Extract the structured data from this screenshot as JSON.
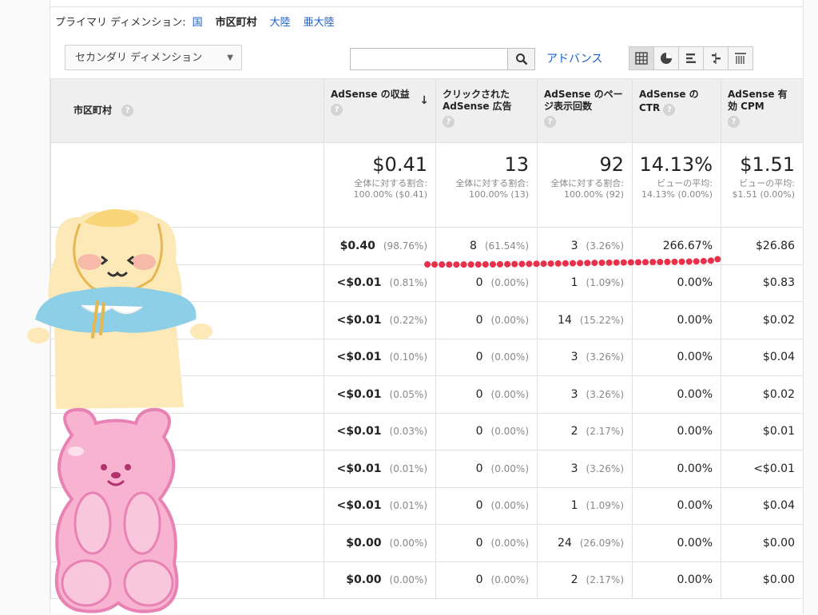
{
  "primary_dimension": {
    "label": "プライマリ ディメンション:",
    "options": [
      {
        "label": "国",
        "active": false
      },
      {
        "label": "市区町村",
        "active": true
      },
      {
        "label": "大陸",
        "active": false
      },
      {
        "label": "亜大陸",
        "active": false
      }
    ]
  },
  "toolbar": {
    "secondary_dimension": "セカンダリ ディメンション",
    "search_value": "",
    "advanced_label": "アドバンス",
    "views": [
      "table-view-icon",
      "pie-view-icon",
      "bar-view-icon",
      "comparison-view-icon",
      "pivot-view-icon"
    ],
    "active_view": 0
  },
  "table": {
    "dimension_header": "市区町村",
    "columns": [
      {
        "label": "AdSense の収益",
        "sorted": true
      },
      {
        "label": "クリックされた AdSense 広告",
        "sorted": false
      },
      {
        "label": "AdSense のページ表示回数",
        "sorted": false
      },
      {
        "label": "AdSense の CTR",
        "sorted": false
      },
      {
        "label": "AdSense 有効 CPM",
        "sorted": false
      }
    ],
    "totals": [
      {
        "main": "$0.41",
        "sub": "全体に対する割合: 100.00% ($0.41)"
      },
      {
        "main": "13",
        "sub": "全体に対する割合: 100.00% (13)"
      },
      {
        "main": "92",
        "sub": "全体に対する割合: 100.00% (92)"
      },
      {
        "main": "14.13%",
        "sub": "ビューの平均: 14.13% (0.00%)"
      },
      {
        "main": "$1.51",
        "sub": "ビューの平均: $1.51 (0.00%)"
      }
    ],
    "rows": [
      {
        "revenue": "$0.40",
        "revenue_pct": "(98.76%)",
        "clicks": "8",
        "clicks_pct": "(61.54%)",
        "views": "3",
        "views_pct": "(3.26%)",
        "ctr": "266.67%",
        "cpm": "$26.86"
      },
      {
        "revenue": "<$0.01",
        "revenue_pct": "(0.81%)",
        "clicks": "0",
        "clicks_pct": "(0.00%)",
        "views": "1",
        "views_pct": "(1.09%)",
        "ctr": "0.00%",
        "cpm": "$0.83"
      },
      {
        "revenue": "<$0.01",
        "revenue_pct": "(0.22%)",
        "clicks": "0",
        "clicks_pct": "(0.00%)",
        "views": "14",
        "views_pct": "(15.22%)",
        "ctr": "0.00%",
        "cpm": "$0.02"
      },
      {
        "revenue": "<$0.01",
        "revenue_pct": "(0.10%)",
        "clicks": "0",
        "clicks_pct": "(0.00%)",
        "views": "3",
        "views_pct": "(3.26%)",
        "ctr": "0.00%",
        "cpm": "$0.04"
      },
      {
        "revenue": "<$0.01",
        "revenue_pct": "(0.05%)",
        "clicks": "0",
        "clicks_pct": "(0.00%)",
        "views": "3",
        "views_pct": "(3.26%)",
        "ctr": "0.00%",
        "cpm": "$0.02"
      },
      {
        "revenue": "<$0.01",
        "revenue_pct": "(0.03%)",
        "clicks": "0",
        "clicks_pct": "(0.00%)",
        "views": "2",
        "views_pct": "(2.17%)",
        "ctr": "0.00%",
        "cpm": "$0.01"
      },
      {
        "revenue": "<$0.01",
        "revenue_pct": "(0.01%)",
        "clicks": "0",
        "clicks_pct": "(0.00%)",
        "views": "3",
        "views_pct": "(3.26%)",
        "ctr": "0.00%",
        "cpm": "<$0.01"
      },
      {
        "revenue": "<$0.01",
        "revenue_pct": "(0.01%)",
        "clicks": "0",
        "clicks_pct": "(0.00%)",
        "views": "1",
        "views_pct": "(1.09%)",
        "ctr": "0.00%",
        "cpm": "$0.04"
      },
      {
        "revenue": "$0.00",
        "revenue_pct": "(0.00%)",
        "clicks": "0",
        "clicks_pct": "(0.00%)",
        "views": "24",
        "views_pct": "(26.09%)",
        "ctr": "0.00%",
        "cpm": "$0.00"
      },
      {
        "revenue": "$0.00",
        "revenue_pct": "(0.00%)",
        "clicks": "0",
        "clicks_pct": "(0.00%)",
        "views": "2",
        "views_pct": "(2.17%)",
        "ctr": "0.00%",
        "cpm": "$0.00"
      }
    ]
  },
  "colors": {
    "link": "#1a5fc9",
    "header_bg": "#efefef",
    "highlight_dots": "#e8304a",
    "bear_yellow": "#fde9b8",
    "bear_cape": "#8ecfe8",
    "bear_pink": "#f7b3cf"
  }
}
